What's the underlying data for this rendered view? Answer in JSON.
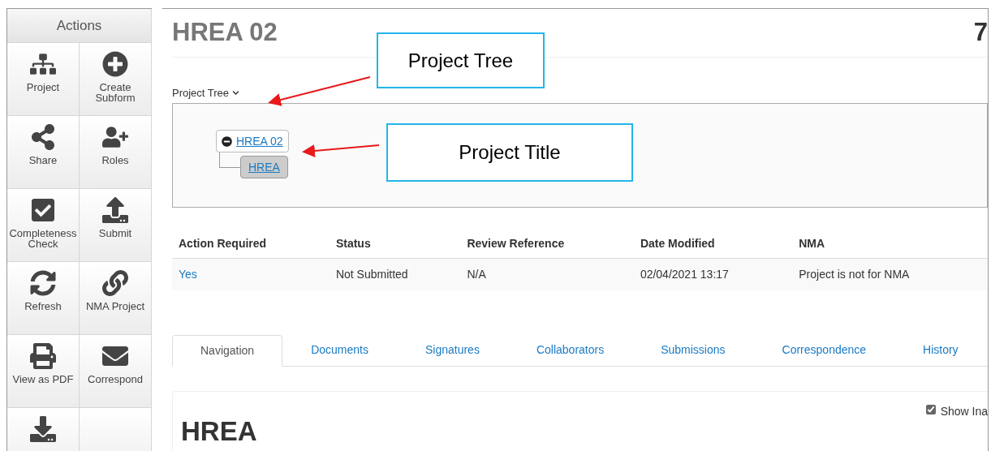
{
  "sidebar": {
    "title": "Actions",
    "items": [
      {
        "kind": "project",
        "label": "Project"
      },
      {
        "kind": "create",
        "label": "Create Subform"
      },
      {
        "kind": "share",
        "label": "Share"
      },
      {
        "kind": "roles",
        "label": "Roles"
      },
      {
        "kind": "check",
        "label": "Completeness Check"
      },
      {
        "kind": "submit",
        "label": "Submit"
      },
      {
        "kind": "refresh",
        "label": "Refresh"
      },
      {
        "kind": "link",
        "label": "NMA Project"
      },
      {
        "kind": "pdf",
        "label": "View as PDF"
      },
      {
        "kind": "mail",
        "label": "Correspond"
      },
      {
        "kind": "import"
      },
      {
        "kind": "blank"
      }
    ]
  },
  "header": {
    "title": "HREA 02",
    "right_text": "7"
  },
  "project_tree": {
    "label": "Project Tree",
    "expanded": true,
    "root": {
      "title": "HREA 02",
      "children": [
        {
          "title": "HREA"
        }
      ]
    }
  },
  "table": {
    "columns": [
      "Action Required",
      "Status",
      "Review Reference",
      "Date Modified",
      "NMA"
    ],
    "rows": [
      [
        "Yes",
        "Not Submitted",
        "N/A",
        "02/04/2021 13:17",
        "Project is not for NMA"
      ]
    ]
  },
  "tabs": [
    {
      "label": "Navigation",
      "selected": true
    },
    {
      "label": "Documents",
      "selected": false
    },
    {
      "label": "Signatures",
      "selected": false
    },
    {
      "label": "Collaborators",
      "selected": false
    },
    {
      "label": "Submissions",
      "selected": false
    },
    {
      "label": "Correspondence",
      "selected": false
    },
    {
      "label": "History",
      "selected": false
    }
  ],
  "panel": {
    "heading": "HREA",
    "show_option": {
      "label": "Show Ina",
      "checked": true
    }
  },
  "annotations": [
    {
      "text": "Project Tree"
    },
    {
      "text": "Project Title"
    }
  ]
}
